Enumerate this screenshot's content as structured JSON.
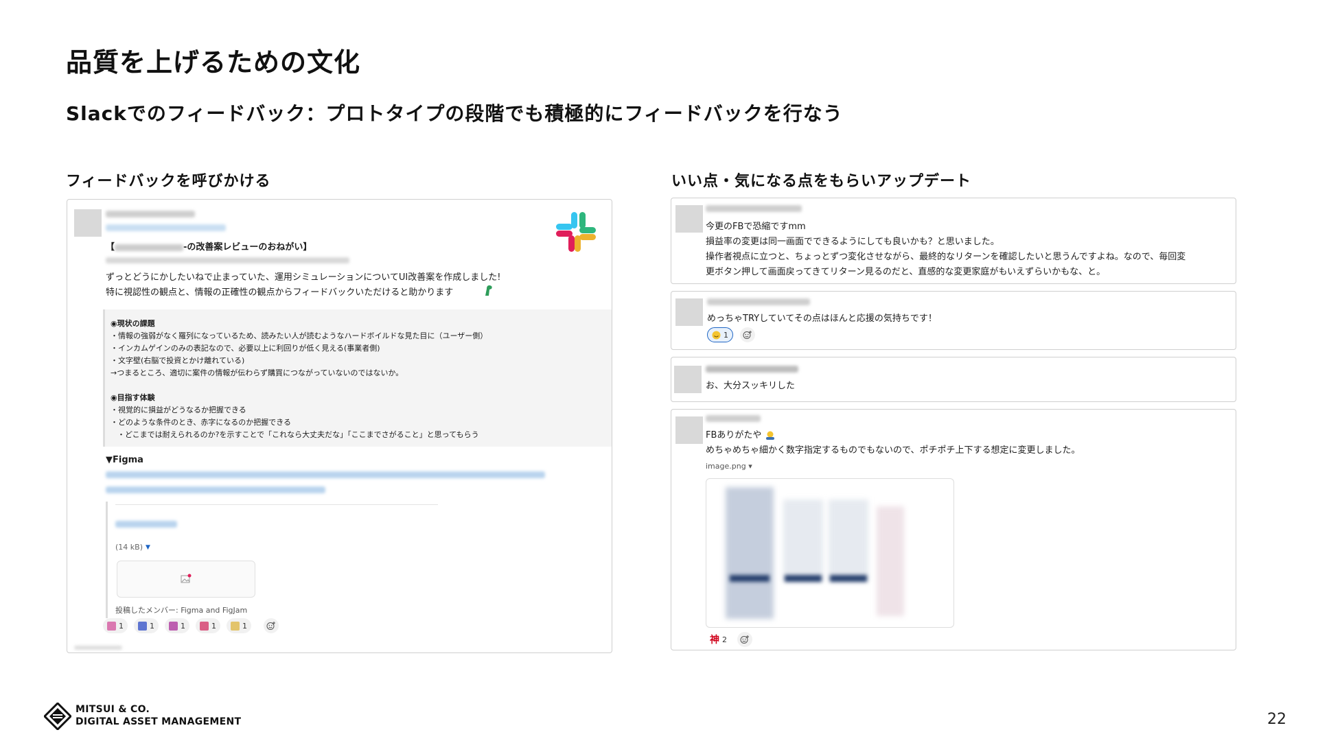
{
  "slide": {
    "title": "品質を上げるための文化",
    "subtitle": "Slackでのフィードバック：プロトタイプの段階でも積極的にフィードバックを行なう",
    "page_number": "22"
  },
  "left": {
    "heading": "フィードバックを呼びかける",
    "post": {
      "title_suffix": "-の改善案レビューのおねがい】",
      "title_prefix": "【",
      "line1": "ずっとどうにかしたいねで止まっていた、運用シミュレーションについてUI改善案を作成しました!",
      "line2": "特に視認性の観点と、情報の正確性の観点からフィードバックいただけると助かります",
      "quote": {
        "h1": "◉現状の課題",
        "b1": "・情報の強弱がなく羅列になっているため、読みたい人が読むようなハードボイルドな見た目に（ユーザー側）",
        "b2": "・インカムゲインのみの表記なので、必要以上に利回りが低く見える(事業者側)",
        "b3": "・文字壁(右脳で投資とかけ離れている)",
        "b4": "→つまるところ、適切に案件の情報が伝わらず購買につながっていないのではないか。",
        "h2": "◉目指す体験",
        "c1": "・視覚的に損益がどうなるか把握できる",
        "c2": "・どのような条件のとき、赤字になるのか把握できる",
        "c3": "・どこまでは耐えられるのか?を示すことで「これなら大丈夫だな」「ここまでさがること」と思ってもらう"
      },
      "figma_label": "▼Figma",
      "file_size": "(14 kB)",
      "posted_by": "投稿したメンバー: Figma and FigJam",
      "reactions": [
        {
          "icon": "stamp-icon",
          "color": "#d55aa0",
          "count": "1"
        },
        {
          "icon": "stamp-icon",
          "color": "#3a56c9",
          "count": "1"
        },
        {
          "icon": "stamp-icon",
          "color": "#b03aa0",
          "count": "1"
        },
        {
          "icon": "stamp-icon",
          "color": "#d53a6a",
          "count": "1"
        },
        {
          "icon": "stamp-icon",
          "color": "#e0b94a",
          "count": "1"
        }
      ]
    }
  },
  "right": {
    "heading": "いい点・気になる点をもらいアップデート",
    "msg1": {
      "l1": "今更のFBで恐縮ですmm",
      "l2": "損益率の変更は同一画面でできるようにしても良いかも？と思いました。",
      "l3": "操作者視点に立つと、ちょっとずつ変化させながら、最終的なリターンを確認したいと思うんですよね。なので、毎回変",
      "l4": "更ボタン押して画面戻ってきてリターン見るのだと、直感的な変更家庭がもいえずらいかもな、と。"
    },
    "msg2": {
      "l1": "めっちゃTRYしていてその点はほんと応援の気持ちです！",
      "reaction_count": "1"
    },
    "msg3": {
      "l1": "お、大分スッキリした"
    },
    "msg4": {
      "l1": "FBありがたや",
      "l2": "めちゃめちゃ細かく数字指定するものでもないので、ポチポチ上下する想定に変更しました。",
      "file": "image.png ▾",
      "reaction_label": "神",
      "reaction_count": "2"
    }
  },
  "footer": {
    "line1": "MITSUI & CO.",
    "line2": "DIGITAL ASSET MANAGEMENT"
  },
  "colors": {
    "slack_blue": "#36C5F0",
    "slack_green": "#2EB67D",
    "slack_yellow": "#ECB22E",
    "slack_red": "#E01E5A"
  }
}
